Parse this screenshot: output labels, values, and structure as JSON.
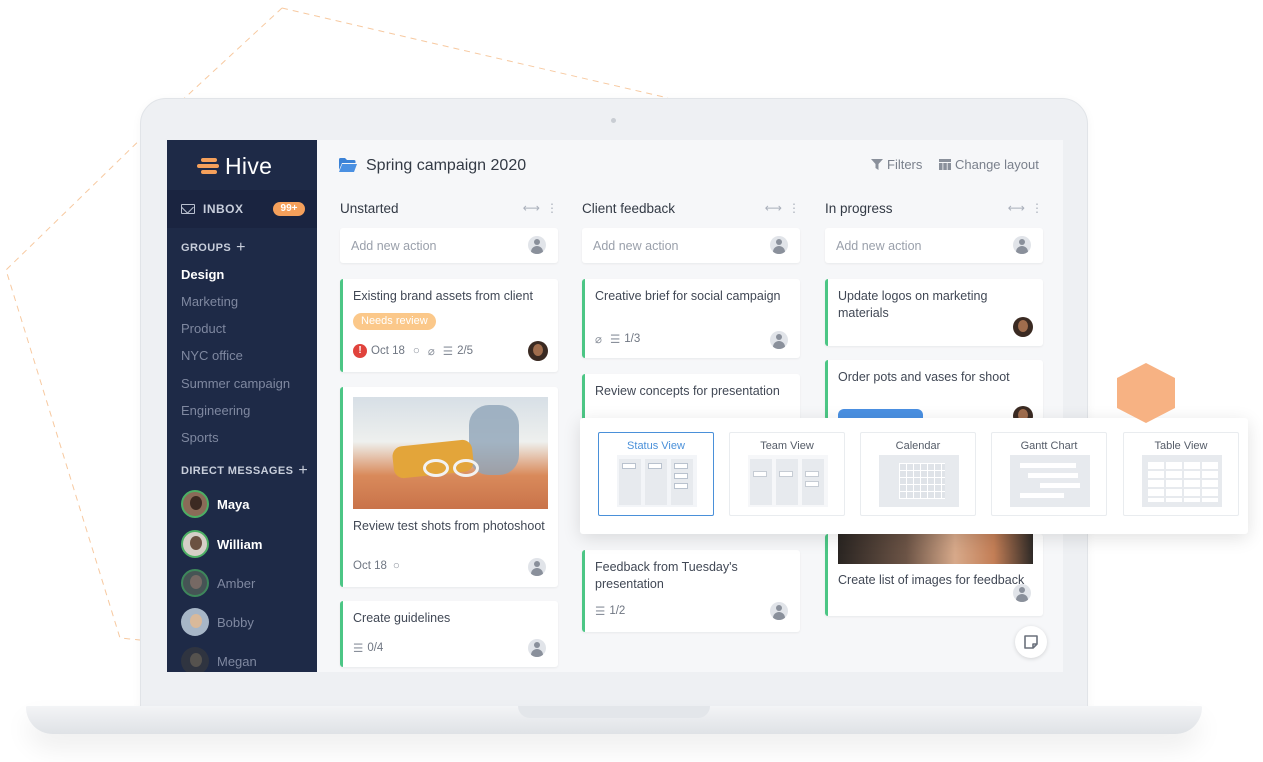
{
  "colors": {
    "sidebar": "#1e2a47",
    "accent": "#f5a05b",
    "card_bar": "#4cc685",
    "active_view": "#4a90d9",
    "tag_review": "#fbc88a",
    "tag_blue": "#4a90e2"
  },
  "brand": {
    "name": "Hive"
  },
  "sidebar": {
    "inbox_label": "INBOX",
    "inbox_badge": "99+",
    "groups_title": "GROUPS",
    "groups_plus": "+",
    "groups": [
      "Design",
      "Marketing",
      "Product",
      "NYC office",
      "Summer campaign",
      "Engineering",
      "Sports"
    ],
    "dm_title": "DIRECT MESSAGES",
    "dm_plus": "+",
    "dms": [
      "Maya",
      "William",
      "Amber",
      "Bobby",
      "Megan"
    ]
  },
  "header": {
    "project_title": "Spring campaign 2020",
    "filters": "Filters",
    "change_layout": "Change layout"
  },
  "columns": [
    {
      "title": "Unstarted",
      "add_placeholder": "Add new action"
    },
    {
      "title": "Client feedback",
      "add_placeholder": "Add new action"
    },
    {
      "title": "In progress",
      "add_placeholder": "Add new action"
    }
  ],
  "cards": {
    "c1": {
      "title": "Existing brand assets from client",
      "tag": "Needs review",
      "date": "Oct 18",
      "subtasks": "2/5"
    },
    "c2": {
      "title": "Review test shots from photoshoot",
      "date": "Oct 18"
    },
    "c3": {
      "title": "Create guidelines",
      "subtasks": "0/4"
    },
    "c4": {
      "title": "Creative brief for social campaign",
      "subtasks": "1/3"
    },
    "c5": {
      "title": "Review concepts for presentation"
    },
    "c6": {
      "title": "Feedback from Tuesday's presentation",
      "subtasks": "1/2"
    },
    "c7": {
      "title": "Update logos on marketing materials"
    },
    "c8": {
      "title": "Order pots and vases for shoot"
    },
    "c9": {
      "title": "Create list of images for feedback"
    }
  },
  "views": [
    "Status View",
    "Team View",
    "Calendar",
    "Gantt Chart",
    "Table View"
  ]
}
